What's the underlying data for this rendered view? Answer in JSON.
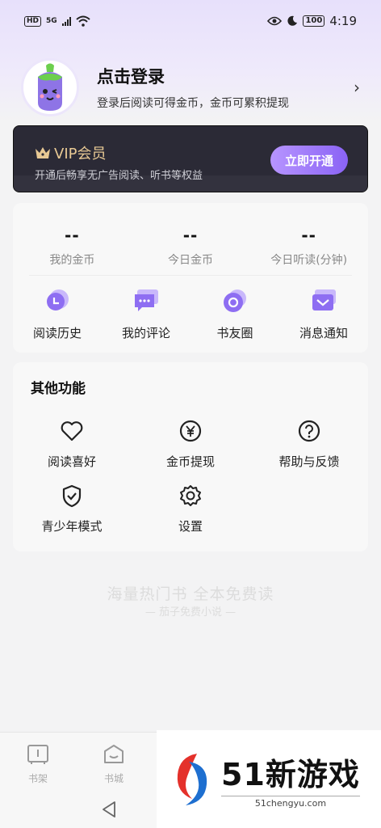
{
  "status_bar": {
    "hd_badge": "HD",
    "signal_label": "5G",
    "battery": "100",
    "time": "4:19"
  },
  "profile": {
    "title": "点击登录",
    "subtitle": "登录后阅读可得金币，金币可累积提现",
    "chevron": "›"
  },
  "vip": {
    "title": "VIP会员",
    "subtitle": "开通后畅享无广告阅读、听书等权益",
    "button": "立即开通"
  },
  "stats": [
    {
      "value": "--",
      "label": "我的金币"
    },
    {
      "value": "--",
      "label": "今日金币"
    },
    {
      "value": "--",
      "label": "今日听读(分钟)"
    }
  ],
  "quick_links": [
    {
      "label": "阅读历史",
      "icon": "history-icon"
    },
    {
      "label": "我的评论",
      "icon": "comment-icon"
    },
    {
      "label": "书友圈",
      "icon": "book-circle-icon"
    },
    {
      "label": "消息通知",
      "icon": "message-icon"
    }
  ],
  "other": {
    "title": "其他功能",
    "items": [
      {
        "label": "阅读喜好",
        "icon": "heart-icon"
      },
      {
        "label": "金币提现",
        "icon": "yen-icon"
      },
      {
        "label": "帮助与反馈",
        "icon": "help-icon"
      },
      {
        "label": "青少年模式",
        "icon": "shield-icon"
      },
      {
        "label": "设置",
        "icon": "gear-icon"
      }
    ]
  },
  "slogan": {
    "main": "海量热门书 全本免费读",
    "sub": "— 茄子免费小说 —"
  },
  "bottom_nav": [
    {
      "label": "书架",
      "icon": "bookshelf-icon"
    },
    {
      "label": "书城",
      "icon": "bookstore-icon"
    }
  ],
  "watermark": {
    "title": "51新游戏",
    "sub": "51chengyu.com"
  },
  "colors": {
    "accent": "#8a63f5",
    "vip_gold": "#e8c994",
    "vip_bg": "#2b2a36"
  }
}
